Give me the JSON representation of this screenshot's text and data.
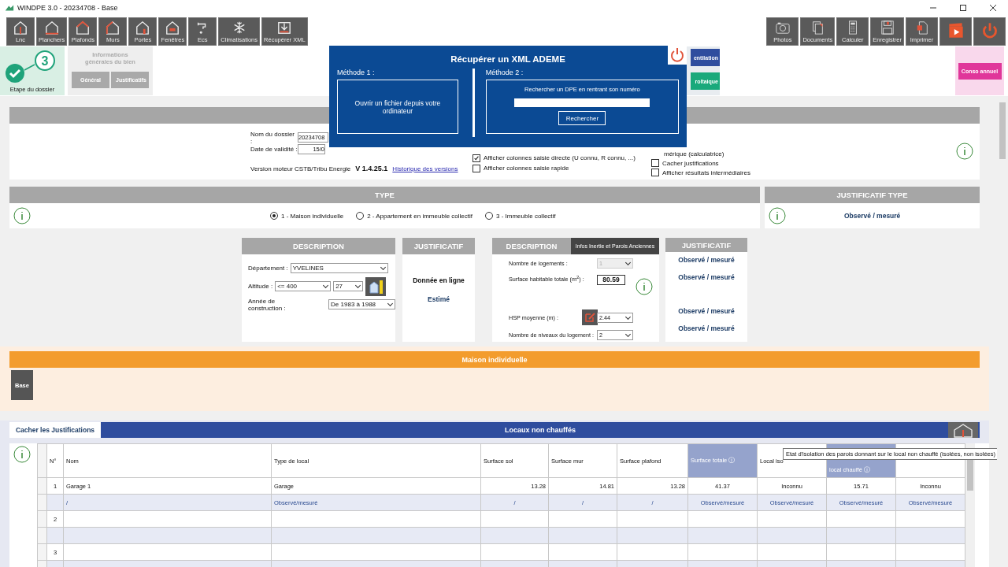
{
  "window": {
    "title": "WINDPE 3.0 - 20234708 - Base"
  },
  "toolbar_left": [
    {
      "label": "Lnc",
      "kind": "lnc"
    },
    {
      "label": "Planchers",
      "kind": "floor"
    },
    {
      "label": "Plafonds",
      "kind": "ceiling"
    },
    {
      "label": "Murs",
      "kind": "walls"
    },
    {
      "label": "Portes",
      "kind": "door"
    },
    {
      "label": "Fenêtres",
      "kind": "window"
    },
    {
      "label": "Ecs",
      "kind": "tap"
    },
    {
      "label": "Climatisations",
      "kind": "snow"
    },
    {
      "label": "Récupérer XML",
      "kind": "download"
    }
  ],
  "toolbar_right": [
    {
      "label": "Photos",
      "kind": "camera"
    },
    {
      "label": "Documents",
      "kind": "documents"
    },
    {
      "label": "Calculer",
      "kind": "calculator"
    },
    {
      "label": "Enregistrer",
      "kind": "save"
    },
    {
      "label": "Imprimer",
      "kind": "print"
    },
    {
      "kind": "video"
    },
    {
      "kind": "power"
    }
  ],
  "step": {
    "number": "3",
    "label": "Etape du dossier",
    "done": true
  },
  "info_panel": {
    "title": "Informations générales du bien",
    "tabs": [
      "Général",
      "Justificatifs"
    ]
  },
  "side_buttons": [
    {
      "label": "entilation",
      "color": "#2f4d9e"
    },
    {
      "label": "roltaique",
      "color": "#19a97b"
    }
  ],
  "conso_button": "Conso annuel",
  "modal": {
    "title": "Récupérer un XML ADEME",
    "method_1": {
      "label": "Méthode 1 :",
      "button": "Ouvrir un fichier depuis votre ordinateur"
    },
    "method_2": {
      "label": "Méthode 2 :",
      "prompt": "Rechercher un DPE en rentrant son numéro",
      "button": "Rechercher"
    }
  },
  "general": {
    "fields": [
      {
        "label": "Nom du dossier :",
        "value": "20234708"
      },
      {
        "label": "Date de validité :",
        "value": "15/0"
      }
    ],
    "version_label": "Version moteur CSTB/Tribu Energie",
    "version": "V 1.4.25.1",
    "history_link": "Historique des versions",
    "options": [
      {
        "label": "Afficher colonnes saisie directe (U connu, R connu, ...)",
        "checked": true
      },
      {
        "label": "Afficher colonnes saisie rapide",
        "checked": false
      }
    ],
    "options_right": [
      {
        "kind": "text",
        "label": "mérique (calculatrice)"
      },
      {
        "kind": "checkbox",
        "label": "Cacher justifications",
        "checked": false
      },
      {
        "kind": "checkbox",
        "label": "Afficher résultats intermédiaires",
        "checked": false
      }
    ]
  },
  "type_section": {
    "title": "TYPE",
    "options": [
      {
        "label": "1 - Maison individuelle",
        "selected": true
      },
      {
        "label": "2 - Appartement en immeuble collectif",
        "selected": false
      },
      {
        "label": "3 - Immeuble collectif",
        "selected": false
      }
    ]
  },
  "justificatif_type": {
    "title": "JUSTIFICATIF TYPE",
    "value": "Observé / mesuré"
  },
  "description": {
    "title": "DESCRIPTION",
    "departement": {
      "label": "Département :",
      "value": "YVELINES"
    },
    "altitude": {
      "label": "Altitude :",
      "value": "<= 400",
      "value_2": "27"
    },
    "annee": {
      "label": "Année de construction :",
      "value": "De 1983 à 1988"
    }
  },
  "justificatif": {
    "title": "JUSTIFICATIF",
    "lines": [
      {
        "kind": "main",
        "text": "Donnée en ligne"
      },
      {
        "kind": "value",
        "text": "Estimé"
      }
    ]
  },
  "description_2": {
    "title": "DESCRIPTION",
    "tab": "Infos Inertie et Parois Anciennes",
    "fields": [
      {
        "label": "Nombre de logements :",
        "value": "1",
        "kind": "select",
        "disabled": true
      },
      {
        "label": "Surface habitable totale (m$^{2}$) :",
        "value": "80.59",
        "kind": "input",
        "disabled": false
      },
      {
        "label": "HSP moyenne (m) :",
        "value": "2.44",
        "kind": "select",
        "disabled": false
      },
      {
        "label": "Nombre de niveaux du logement :",
        "value": "2",
        "kind": "select",
        "disabled": false
      }
    ]
  },
  "justificatif_2": {
    "title": "JUSTIFICATIF",
    "values": [
      "Observé / mesuré",
      "Observé / mesuré",
      "Observé / mesuré",
      "Observé / mesuré"
    ]
  },
  "maison": {
    "title": "Maison individuelle",
    "tab": "Base"
  },
  "locaux": {
    "toggle": "Cacher les Justifications",
    "title": "Locaux non chauffés",
    "columns": [
      {
        "label": "N°",
        "highlighted": false
      },
      {
        "label": "Nom",
        "highlighted": false
      },
      {
        "label": "Type de local",
        "highlighted": false
      },
      {
        "label": "Surface sol",
        "highlighted": false
      },
      {
        "label": "Surface mur",
        "highlighted": false
      },
      {
        "label": "Surface plafond",
        "highlighted": false
      },
      {
        "label": "Surface totale ⓘ",
        "highlighted": true
      },
      {
        "label": "Local iso",
        "highlighted": false
      },
      {
        "label": "local chauffé ⓘ",
        "highlighted": true
      },
      {
        "highlighted": false
      }
    ],
    "rows": [
      {
        "kind": "data",
        "number": "1",
        "cells": [
          "Garage 1",
          "Garage",
          "13.28",
          "14.81",
          "13.28",
          "41.37",
          "Inconnu",
          "15.71",
          "Inconnu"
        ]
      },
      {
        "kind": "justification",
        "cells": [
          "/",
          "Observé/mesuré",
          "/",
          "/",
          "/",
          "Observé/mesuré",
          "Observé/mesuré",
          "Observé/mesuré",
          "Observé/mesuré"
        ]
      },
      {
        "kind": "empty",
        "number": "2"
      },
      {
        "kind": "blank"
      },
      {
        "kind": "empty",
        "number": "3"
      },
      {
        "kind": "blank"
      }
    ],
    "tooltip": "Etat d'isolation des parois donnant sur le local non chauffé (isolées, non isolées)"
  }
}
